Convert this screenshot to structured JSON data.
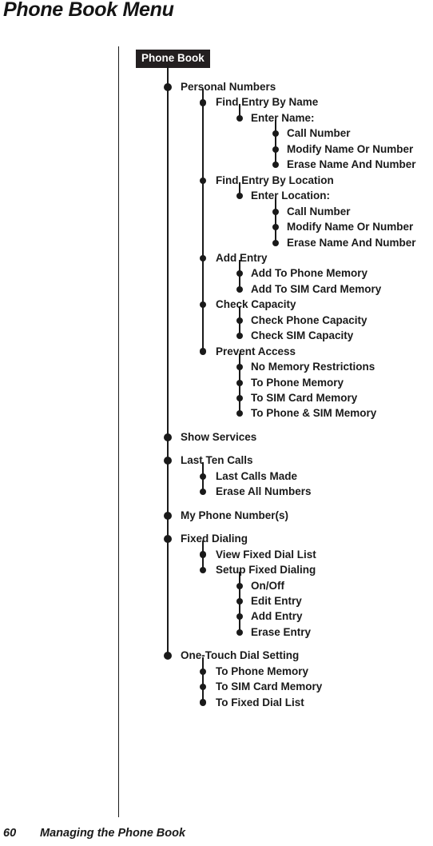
{
  "page": {
    "title": "Phone Book Menu",
    "footer_page_number": "60",
    "footer_section": "Managing the Phone Book",
    "root_label": "Phone Book",
    "ink_color": "#1a1a1a",
    "root_box_bg": "#231f20",
    "root_box_fg": "#ffffff",
    "background": "#ffffff"
  },
  "tree": {
    "root": "Phone Book",
    "nodes": [
      {
        "level": 1,
        "label": "Personal Numbers"
      },
      {
        "level": 2,
        "label": "Find Entry By Name"
      },
      {
        "level": 3,
        "label": "Enter Name:"
      },
      {
        "level": 4,
        "label": "Call Number"
      },
      {
        "level": 4,
        "label": "Modify Name Or Number"
      },
      {
        "level": 4,
        "label": "Erase Name And Number"
      },
      {
        "level": 2,
        "label": "Find Entry By Location"
      },
      {
        "level": 3,
        "label": "Enter Location:"
      },
      {
        "level": 4,
        "label": "Call Number"
      },
      {
        "level": 4,
        "label": "Modify Name Or Number"
      },
      {
        "level": 4,
        "label": "Erase Name And Number"
      },
      {
        "level": 2,
        "label": "Add Entry"
      },
      {
        "level": 3,
        "label": "Add To Phone Memory"
      },
      {
        "level": 3,
        "label": "Add To SIM Card Memory"
      },
      {
        "level": 2,
        "label": "Check Capacity"
      },
      {
        "level": 3,
        "label": "Check Phone Capacity"
      },
      {
        "level": 3,
        "label": "Check SIM Capacity"
      },
      {
        "level": 2,
        "label": "Prevent Access"
      },
      {
        "level": 3,
        "label": "No Memory Restrictions"
      },
      {
        "level": 3,
        "label": "To Phone Memory"
      },
      {
        "level": 3,
        "label": "To SIM Card Memory"
      },
      {
        "level": 3,
        "label": "To Phone & SIM Memory"
      },
      {
        "level": 1,
        "label": "Show Services"
      },
      {
        "level": 1,
        "label": "Last Ten Calls"
      },
      {
        "level": 2,
        "label": "Last Calls Made"
      },
      {
        "level": 2,
        "label": "Erase All Numbers"
      },
      {
        "level": 1,
        "label": "My Phone Number(s)"
      },
      {
        "level": 1,
        "label": "Fixed Dialing"
      },
      {
        "level": 2,
        "label": "View Fixed Dial List"
      },
      {
        "level": 2,
        "label": "Setup Fixed Dialing"
      },
      {
        "level": 3,
        "label": "On/Off"
      },
      {
        "level": 3,
        "label": "Edit Entry"
      },
      {
        "level": 3,
        "label": "Add Entry"
      },
      {
        "level": 3,
        "label": "Erase Entry"
      },
      {
        "level": 1,
        "label": "One-Touch Dial Setting"
      },
      {
        "level": 2,
        "label": "To Phone Memory"
      },
      {
        "level": 2,
        "label": "To SIM Card Memory"
      },
      {
        "level": 2,
        "label": "To Fixed Dial List"
      }
    ]
  }
}
